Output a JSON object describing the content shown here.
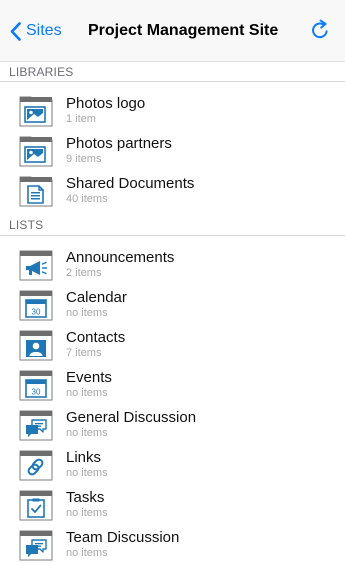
{
  "nav": {
    "back_label": "Sites",
    "title": "Project Management Site",
    "accent_color": "#0a7aff"
  },
  "libraries": {
    "header": "LIBRARIES",
    "items": [
      {
        "title": "Photos logo",
        "count": "1 item",
        "icon": "picture-library-icon"
      },
      {
        "title": "Photos partners",
        "count": "9 items",
        "icon": "picture-library-icon"
      },
      {
        "title": "Shared Documents",
        "count": "40 items",
        "icon": "document-library-icon"
      }
    ]
  },
  "lists": {
    "header": "LISTS",
    "items": [
      {
        "title": "Announcements",
        "count": "2 items",
        "icon": "megaphone-icon"
      },
      {
        "title": "Calendar",
        "count": "no items",
        "icon": "calendar-icon",
        "icon_text": "30"
      },
      {
        "title": "Contacts",
        "count": "7 items",
        "icon": "contact-icon"
      },
      {
        "title": "Events",
        "count": "no items",
        "icon": "calendar-icon",
        "icon_text": "30"
      },
      {
        "title": "General Discussion",
        "count": "no items",
        "icon": "discussion-icon"
      },
      {
        "title": "Links",
        "count": "no items",
        "icon": "link-icon"
      },
      {
        "title": "Tasks",
        "count": "no items",
        "icon": "task-icon"
      },
      {
        "title": "Team Discussion",
        "count": "no items",
        "icon": "discussion-icon"
      }
    ]
  }
}
